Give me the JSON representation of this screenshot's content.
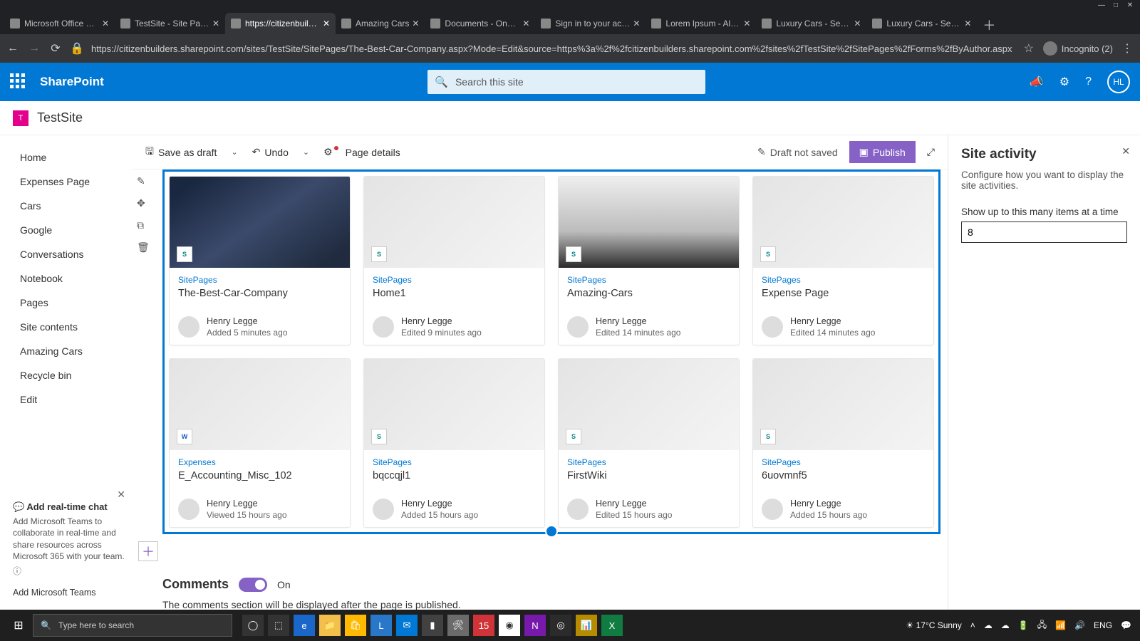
{
  "window": {
    "min": "—",
    "max": "□",
    "close": "✕"
  },
  "tabs": [
    {
      "label": "Microsoft Office Home",
      "active": false
    },
    {
      "label": "TestSite - Site Pages -",
      "active": false
    },
    {
      "label": "https://citizenbuilders",
      "active": true
    },
    {
      "label": "Amazing Cars",
      "active": false
    },
    {
      "label": "Documents - OneDri…",
      "active": false
    },
    {
      "label": "Sign in to your accou…",
      "active": false
    },
    {
      "label": "Lorem Ipsum - All the",
      "active": false
    },
    {
      "label": "Luxury Cars - Sedans,",
      "active": false
    },
    {
      "label": "Luxury Cars - Sedans,",
      "active": false
    }
  ],
  "newtab": "＋",
  "addr": {
    "back": "←",
    "fwd": "→",
    "reload": "⟳",
    "lock": "🔒",
    "url": "https://citizenbuilders.sharepoint.com/sites/TestSite/SitePages/The-Best-Car-Company.aspx?Mode=Edit&source=https%3a%2f%2fcitizenbuilders.sharepoint.com%2fsites%2fTestSite%2fSitePages%2fForms%2fByAuthor.aspx",
    "star": "☆",
    "incog": "Incognito (2)",
    "menu": "⋮"
  },
  "suite": {
    "brand": "SharePoint",
    "search_placeholder": "Search this site",
    "mega": "📣",
    "gear": "⚙",
    "help": "?",
    "initials": "HL"
  },
  "site": {
    "logo": "T",
    "name": "TestSite"
  },
  "nav": [
    "Home",
    "Expenses Page",
    "Cars",
    "Google",
    "Conversations",
    "Notebook",
    "Pages",
    "Site contents",
    "Amazing Cars",
    "Recycle bin",
    "Edit"
  ],
  "teams": {
    "title": "Add real-time chat",
    "body": "Add Microsoft Teams to collaborate in real-time and share resources across Microsoft 365 with your team.",
    "link": "Add Microsoft Teams",
    "close": "✕"
  },
  "cmd": {
    "save": "Save as draft",
    "undo": "Undo",
    "details": "Page details",
    "notsaved": "Draft not saved",
    "publish": "Publish"
  },
  "cards": [
    {
      "lib": "SitePages",
      "title": "The-Best-Car-Company",
      "author": "Henry Legge",
      "meta": "Added 5 minutes ago",
      "thumb": "img1",
      "ft": "S"
    },
    {
      "lib": "SitePages",
      "title": "Home1",
      "author": "Henry Legge",
      "meta": "Edited 9 minutes ago",
      "thumb": "",
      "ft": "S"
    },
    {
      "lib": "SitePages",
      "title": "Amazing-Cars",
      "author": "Henry Legge",
      "meta": "Edited 14 minutes ago",
      "thumb": "img3",
      "ft": "S"
    },
    {
      "lib": "SitePages",
      "title": "Expense Page",
      "author": "Henry Legge",
      "meta": "Edited 14 minutes ago",
      "thumb": "",
      "ft": "S"
    },
    {
      "lib": "Expenses",
      "title": "E_Accounting_Misc_102",
      "author": "Henry Legge",
      "meta": "Viewed 15 hours ago",
      "thumb": "",
      "ft": "W"
    },
    {
      "lib": "SitePages",
      "title": "bqccqjl1",
      "author": "Henry Legge",
      "meta": "Added 15 hours ago",
      "thumb": "",
      "ft": "S"
    },
    {
      "lib": "SitePages",
      "title": "FirstWiki",
      "author": "Henry Legge",
      "meta": "Edited 15 hours ago",
      "thumb": "",
      "ft": "S"
    },
    {
      "lib": "SitePages",
      "title": "6uovmnf5",
      "author": "Henry Legge",
      "meta": "Added 15 hours ago",
      "thumb": "",
      "ft": "S"
    }
  ],
  "comments": {
    "heading": "Comments",
    "state": "On",
    "note": "The comments section will be displayed after the page is published."
  },
  "pane": {
    "title": "Site activity",
    "desc": "Configure how you want to display the site activities.",
    "label": "Show up to this many items at a time",
    "value": "8",
    "close": "✕"
  },
  "taskbar": {
    "search_placeholder": "Type here to search",
    "weather": "17°C  Sunny",
    "lang": "ENG"
  }
}
